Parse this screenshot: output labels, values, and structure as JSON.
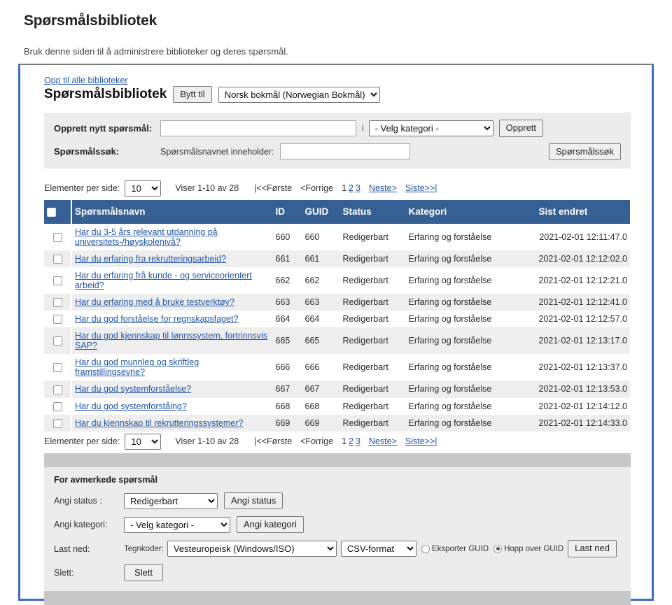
{
  "header": {
    "title": "Spørsmålsbibliotek",
    "subtitle": "Bruk denne siden til å administrere biblioteker og deres spørsmål."
  },
  "library": {
    "up_link": "Opp til alle biblioteker",
    "title": "Spørsmålsbibliotek",
    "switch_button": "Bytt til",
    "language_selected": "Norsk bokmål (Norwegian Bokmål)"
  },
  "create_form": {
    "create_label": "Opprett nytt spørsmål:",
    "create_input_value": "",
    "in_word": "i",
    "category_selected": "- Velg kategori -",
    "create_button": "Opprett",
    "search_label": "Spørsmålssøk:",
    "search_sub_label": "Spørsmålsnavnet inneholder:",
    "search_input_value": "",
    "search_button": "Spørsmålssøk"
  },
  "pagination": {
    "per_page_label": "Elementer per side:",
    "per_page_value": "10",
    "showing": "Viser 1-10 av 28",
    "first": "|<<Første",
    "previous": "<Forrige",
    "pages": [
      "1",
      "2",
      "3"
    ],
    "current_page": "1",
    "next": "Neste>",
    "last": "Siste>>|"
  },
  "table": {
    "columns": {
      "name": "Spørsmålsnavn",
      "id": "ID",
      "guid": "GUID",
      "status": "Status",
      "category": "Kategori",
      "modified": "Sist endret"
    },
    "rows": [
      {
        "name": "Har du 3-5 års relevant utdanning på universitets-/høyskolenivå?",
        "id": "660",
        "guid": "660",
        "status": "Redigerbart",
        "category": "Erfaring og forståelse",
        "modified": "2021-02-01 12:11:47.0"
      },
      {
        "name": "Har du erfaring fra rekrutteringsarbeid?",
        "id": "661",
        "guid": "661",
        "status": "Redigerbart",
        "category": "Erfaring og forståelse",
        "modified": "2021-02-01 12:12:02.0"
      },
      {
        "name": "Har du erfaring frå kunde - og serviceorientert arbeid?",
        "id": "662",
        "guid": "662",
        "status": "Redigerbart",
        "category": "Erfaring og forståelse",
        "modified": "2021-02-01 12:12:21.0"
      },
      {
        "name": "Har du erfaring med å bruke testverktøy?",
        "id": "663",
        "guid": "663",
        "status": "Redigerbart",
        "category": "Erfaring og forståelse",
        "modified": "2021-02-01 12:12:41.0"
      },
      {
        "name": "Har du god forståelse for regnskapsfaget?",
        "id": "664",
        "guid": "664",
        "status": "Redigerbart",
        "category": "Erfaring og forståelse",
        "modified": "2021-02-01 12:12:57.0"
      },
      {
        "name": "Har du god kjennskap til lønnssystem, fortrinnsvis SAP?",
        "id": "665",
        "guid": "665",
        "status": "Redigerbart",
        "category": "Erfaring og forståelse",
        "modified": "2021-02-01 12:13:17.0"
      },
      {
        "name": "Har du god munnleg og skriftleg framstillingsevne?",
        "id": "666",
        "guid": "666",
        "status": "Redigerbart",
        "category": "Erfaring og forståelse",
        "modified": "2021-02-01 12:13:37.0"
      },
      {
        "name": "Har du god systemforståelse?",
        "id": "667",
        "guid": "667",
        "status": "Redigerbart",
        "category": "Erfaring og forståelse",
        "modified": "2021-02-01 12:13:53.0"
      },
      {
        "name": "Har du god systemforståing?",
        "id": "668",
        "guid": "668",
        "status": "Redigerbart",
        "category": "Erfaring og forståelse",
        "modified": "2021-02-01 12:14:12.0"
      },
      {
        "name": "Har du kjennskap til rekrutteringssystemer?",
        "id": "669",
        "guid": "669",
        "status": "Redigerbart",
        "category": "Erfaring og forståelse",
        "modified": "2021-02-01 12:14:33.0"
      }
    ]
  },
  "bulk": {
    "title": "For avmerkede spørsmål",
    "status_label": "Angi status :",
    "status_selected": "Redigerbart",
    "status_button": "Angi status",
    "category_label": "Angi kategori:",
    "category_selected": "- Velg kategori -",
    "category_button": "Angi kategori",
    "download_label": "Last ned:",
    "charset_label": "Tegnkoder:",
    "charset_selected": "Vesteuropeisk (Windows/ISO)",
    "format_selected": "CSV-format",
    "export_guid_label": "Eksporter GUID",
    "skip_guid_label": "Hopp over GUID",
    "guid_choice": "skip",
    "download_button": "Last ned",
    "delete_label": "Slett:",
    "delete_button": "Slett"
  },
  "colors": {
    "header_blue": "#366093",
    "frame_blue": "#3b6fc4",
    "link_blue": "#2255a5",
    "panel_grey": "#ececec",
    "bar_grey": "#c8c8c8"
  }
}
